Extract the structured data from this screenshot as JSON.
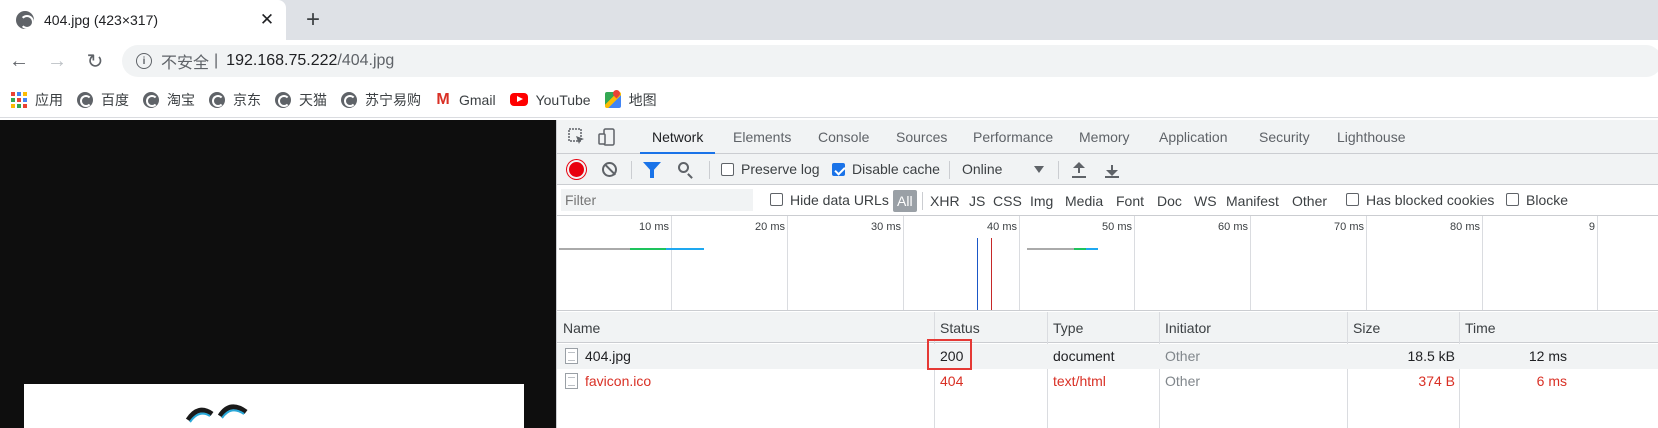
{
  "browser": {
    "tab": {
      "title": "404.jpg (423×317)",
      "close": "✕"
    },
    "newtab_label": "+",
    "nav": {
      "back": "←",
      "forward": "→",
      "reload": "↻"
    },
    "omnibox": {
      "info_glyph": "i",
      "security": "不安全",
      "separator": "|",
      "host": "192.168.75.222",
      "path": "/404.jpg"
    },
    "bookmarks": [
      {
        "label": "应用",
        "icon": "apps-grid-icon"
      },
      {
        "label": "百度",
        "icon": "globe-icon"
      },
      {
        "label": "淘宝",
        "icon": "globe-icon"
      },
      {
        "label": "京东",
        "icon": "globe-icon"
      },
      {
        "label": "天猫",
        "icon": "globe-icon"
      },
      {
        "label": "苏宁易购",
        "icon": "globe-icon"
      },
      {
        "label": "Gmail",
        "icon": "gmail-icon"
      },
      {
        "label": "YouTube",
        "icon": "youtube-icon"
      },
      {
        "label": "地图",
        "icon": "maps-icon"
      }
    ]
  },
  "devtools": {
    "tabs": [
      "Network",
      "Elements",
      "Console",
      "Sources",
      "Performance",
      "Memory",
      "Application",
      "Security",
      "Lighthouse"
    ],
    "active_tab": "Network",
    "toolbar": {
      "preserve_log": {
        "label": "Preserve log",
        "checked": false
      },
      "disable_cache": {
        "label": "Disable cache",
        "checked": true
      },
      "throttling": "Online"
    },
    "filter": {
      "placeholder": "Filter",
      "hide_data_urls": {
        "label": "Hide data URLs",
        "checked": false
      },
      "types": [
        "All",
        "XHR",
        "JS",
        "CSS",
        "Img",
        "Media",
        "Font",
        "Doc",
        "WS",
        "Manifest",
        "Other"
      ],
      "active_type": "All",
      "has_blocked_cookies": {
        "label": "Has blocked cookies",
        "checked": false
      },
      "blocked_requests": {
        "label": "Blocke",
        "checked": false
      }
    },
    "timeline": {
      "ticks": [
        "10 ms",
        "20 ms",
        "30 ms",
        "40 ms",
        "50 ms",
        "60 ms",
        "70 ms",
        "80 ms",
        "9"
      ],
      "colors": {
        "waiting": "#aaaaaa",
        "content": "#1ec35c",
        "download": "#1ea8f0",
        "dom_loaded": "#1a57c7",
        "load": "#c62828"
      }
    },
    "table": {
      "headers": [
        "Name",
        "Status",
        "Type",
        "Initiator",
        "Size",
        "Time"
      ],
      "rows": [
        {
          "name": "404.jpg",
          "status": "200",
          "type": "document",
          "initiator": "Other",
          "size": "18.5 kB",
          "time": "12 ms",
          "error": false
        },
        {
          "name": "favicon.ico",
          "status": "404",
          "type": "text/html",
          "initiator": "Other",
          "size": "374 B",
          "time": "6 ms",
          "error": true
        }
      ],
      "colors": {
        "error_text": "#d93025",
        "highlight_box": "#e53935"
      }
    }
  }
}
